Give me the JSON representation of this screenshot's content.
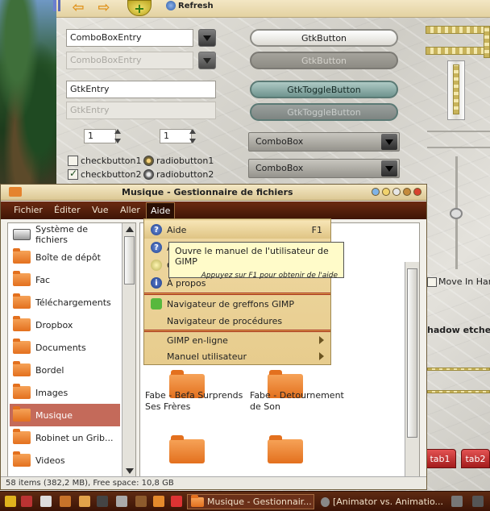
{
  "theme_demo": {
    "toolbar": {
      "refresh_label": "Refresh"
    },
    "combo_entry": {
      "value": "ComboBoxEntry",
      "disabled_value": "ComboBoxEntry"
    },
    "gtk_entry": {
      "value": "GtkEntry",
      "disabled_value": "GtkEntry"
    },
    "spin1": "1",
    "spin2": "1",
    "checkbuttons": [
      "checkbutton1",
      "checkbutton2"
    ],
    "radiobuttons": [
      "radiobutton1",
      "radiobutton2"
    ],
    "buttons": {
      "gtk_button": "GtkButton",
      "gtk_button_disabled": "GtkButton",
      "toggle": "GtkToggleButton",
      "toggle_disabled": "GtkToggleButton"
    },
    "comboboxes": [
      "ComboBox",
      "ComboBox"
    ],
    "right_texts": {
      "move_in": "Move In Har",
      "shadow": "hadow etched"
    },
    "tabs": [
      "tab1",
      "tab2"
    ]
  },
  "file_manager": {
    "title": "Musique - Gestionnaire de fichiers",
    "menu": [
      "Fichier",
      "Éditer",
      "Vue",
      "Aller",
      "Aide"
    ],
    "sidebar": [
      {
        "label": "Système de fichiers",
        "icon": "drive-icon"
      },
      {
        "label": "Boîte de dépôt",
        "icon": "folder-icon"
      },
      {
        "label": "Fac",
        "icon": "folder-icon"
      },
      {
        "label": "Téléchargements",
        "icon": "folder-icon"
      },
      {
        "label": "Dropbox",
        "icon": "folder-icon"
      },
      {
        "label": "Documents",
        "icon": "folder-icon"
      },
      {
        "label": "Bordel",
        "icon": "folder-icon"
      },
      {
        "label": "Images",
        "icon": "folder-icon"
      },
      {
        "label": "Musique",
        "icon": "folder-icon",
        "selected": true
      },
      {
        "label": "Robinet un Grib...",
        "icon": "folder-icon"
      },
      {
        "label": "Videos",
        "icon": "folder-icon"
      }
    ],
    "files": [
      {
        "name": "Fabe - Befa Surprends Ses Frères"
      },
      {
        "name": "Fabe - Detournement de Son"
      }
    ],
    "status": "58 items (382,2 MB), Free space: 10,8 GB"
  },
  "help_menu": {
    "items": [
      {
        "label": "Aide",
        "accel": "F1",
        "icon": "help-icon",
        "highlighted": true
      },
      {
        "label": "A",
        "icon": "help-icon"
      },
      {
        "label": "C",
        "icon": "tip-icon"
      },
      {
        "label": "À propos",
        "icon": "info-icon"
      },
      {
        "label": "Navigateur de greffons GIMP",
        "icon": "plugin-icon"
      },
      {
        "label": "Navigateur de procédures",
        "icon": ""
      },
      {
        "label": "GIMP en-ligne",
        "submenu": true
      },
      {
        "label": "Manuel utilisateur",
        "submenu": true
      }
    ],
    "tooltip": {
      "text": "Ouvre le manuel de l'utilisateur de GIMP",
      "hint": "Appuyez sur F1 pour obtenir de l'aide"
    }
  },
  "taskbar": {
    "tasks": [
      {
        "label": "Musique - Gestionnair...",
        "active": true
      },
      {
        "label": "[Animator vs. Animatio...",
        "active": false
      }
    ]
  }
}
